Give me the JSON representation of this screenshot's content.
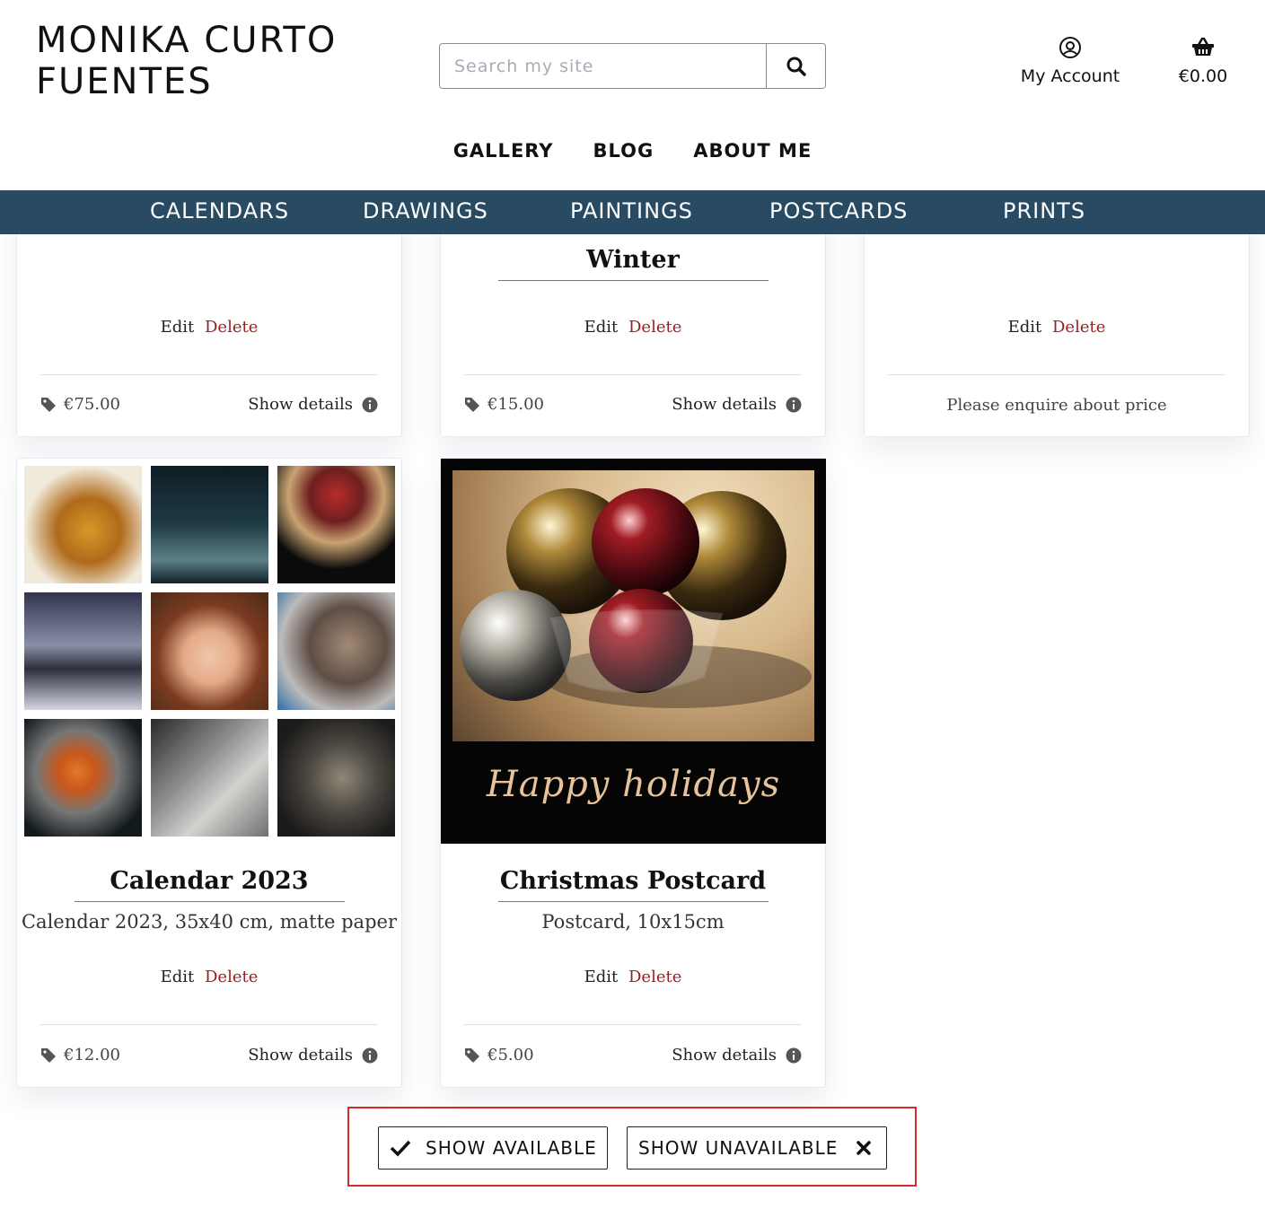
{
  "brand": {
    "line1": "MONIKA CURTO",
    "line2": "FUENTES"
  },
  "search": {
    "placeholder": "Search my site",
    "icon": "search-icon"
  },
  "account": {
    "label": "My Account",
    "icon": "user-circle-icon"
  },
  "cart": {
    "total": "€0.00",
    "icon": "basket-icon"
  },
  "main_nav": [
    "GALLERY",
    "BLOG",
    "ABOUT ME"
  ],
  "categories": [
    "CALENDARS",
    "DRAWINGS",
    "PAINTINGS",
    "POSTCARDS",
    "PRINTS"
  ],
  "colors": {
    "category_bar": "#284a63",
    "delete": "#9b1c1c",
    "filter_highlight": "#d42a2a"
  },
  "products": [
    {
      "title": "",
      "edit": "Edit",
      "delete": "Delete",
      "price": "€75.00",
      "details": "Show details"
    },
    {
      "title": "Winter",
      "edit": "Edit",
      "delete": "Delete",
      "price": "€15.00",
      "details": "Show details"
    },
    {
      "title": "",
      "edit": "Edit",
      "delete": "Delete",
      "price_note": "Please enquire about price"
    },
    {
      "title": "Calendar 2023",
      "description": "Calendar 2023, 35x40 cm, matte paper",
      "edit": "Edit",
      "delete": "Delete",
      "price": "€12.00",
      "details": "Show details"
    },
    {
      "title": "Christmas Postcard",
      "description": "Postcard, 10x15cm",
      "image_text": "Happy holidays",
      "edit": "Edit",
      "delete": "Delete",
      "price": "€5.00",
      "details": "Show details"
    }
  ],
  "filters": {
    "available": "SHOW AVAILABLE",
    "unavailable": "SHOW UNAVAILABLE"
  }
}
